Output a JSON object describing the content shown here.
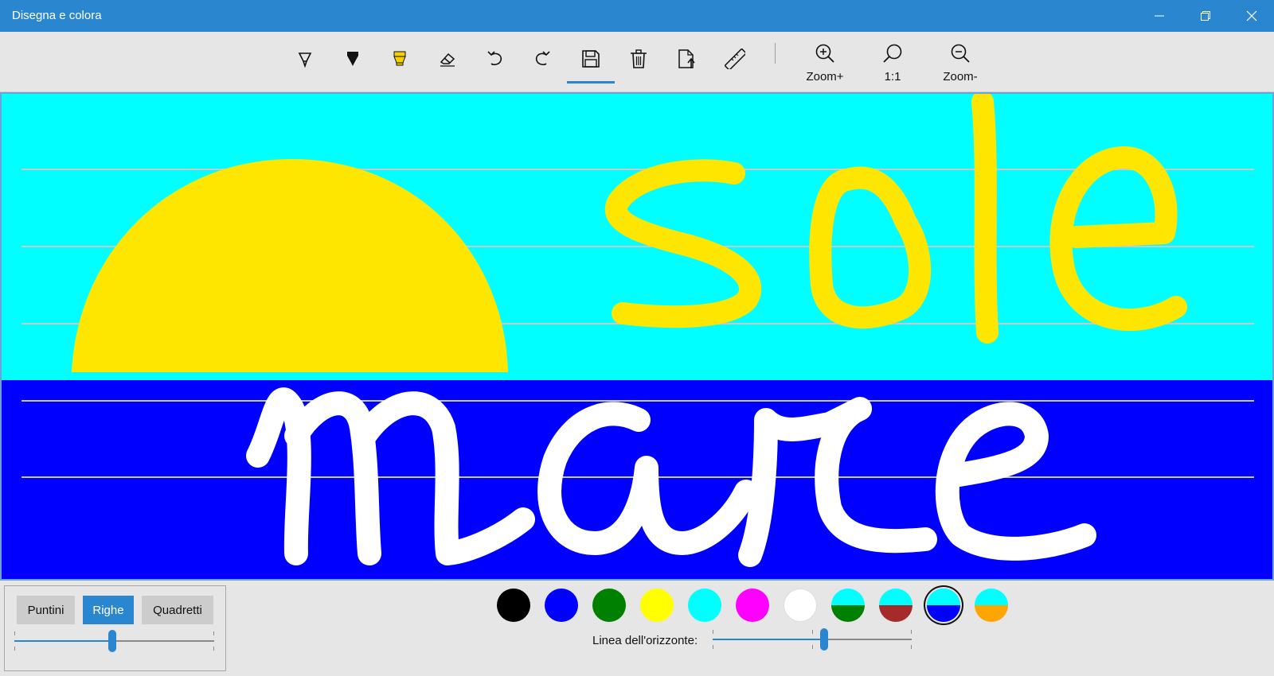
{
  "window": {
    "title": "Disegna e colora",
    "controls": [
      "minimize-icon",
      "restore-icon",
      "close-icon"
    ]
  },
  "toolbar": {
    "tools": [
      {
        "name": "pen",
        "icon": "pen-icon"
      },
      {
        "name": "marker",
        "icon": "marker-icon"
      },
      {
        "name": "highlighter",
        "icon": "highlighter-icon"
      },
      {
        "name": "eraser",
        "icon": "eraser-icon"
      },
      {
        "name": "undo",
        "icon": "undo-icon"
      },
      {
        "name": "redo",
        "icon": "redo-icon"
      },
      {
        "name": "save",
        "icon": "save-icon",
        "active": true
      },
      {
        "name": "delete",
        "icon": "trash-icon"
      },
      {
        "name": "export",
        "icon": "export-icon"
      },
      {
        "name": "ruler",
        "icon": "ruler-icon"
      }
    ],
    "zoom_in_label": "Zoom+",
    "zoom_reset_label": "1:1",
    "zoom_out_label": "Zoom-"
  },
  "canvas": {
    "sky_color": "#00ffff",
    "sea_color": "#0000ff",
    "sun_color": "#ffe600",
    "word_top": "sole",
    "word_bottom": "mare",
    "word_top_color": "#ffe600",
    "word_bottom_color": "#ffffff",
    "guide_line_color": "#c8c8c8"
  },
  "paper": {
    "options": [
      "Puntini",
      "Righe",
      "Quadretti"
    ],
    "selected": "Righe",
    "spacing_level": 0.49
  },
  "palette": {
    "colors": [
      {
        "name": "black",
        "top": "#000000",
        "bottom": "#000000"
      },
      {
        "name": "blue",
        "top": "#0000ff",
        "bottom": "#0000ff"
      },
      {
        "name": "green",
        "top": "#008000",
        "bottom": "#008000"
      },
      {
        "name": "yellow",
        "top": "#ffff00",
        "bottom": "#ffff00"
      },
      {
        "name": "cyan",
        "top": "#00ffff",
        "bottom": "#00ffff"
      },
      {
        "name": "magenta",
        "top": "#ff00ff",
        "bottom": "#ff00ff"
      },
      {
        "name": "white",
        "top": "#ffffff",
        "bottom": "#ffffff"
      },
      {
        "name": "cyan-green",
        "top": "#00ffff",
        "bottom": "#008000"
      },
      {
        "name": "cyan-brown",
        "top": "#00ffff",
        "bottom": "#a52a2a"
      },
      {
        "name": "cyan-blue",
        "top": "#00ffff",
        "bottom": "#0000ff",
        "selected": true
      },
      {
        "name": "cyan-orange",
        "top": "#00ffff",
        "bottom": "#ffa500"
      }
    ]
  },
  "horizon": {
    "label": "Linea dell'orizzonte:",
    "level": 0.56
  }
}
